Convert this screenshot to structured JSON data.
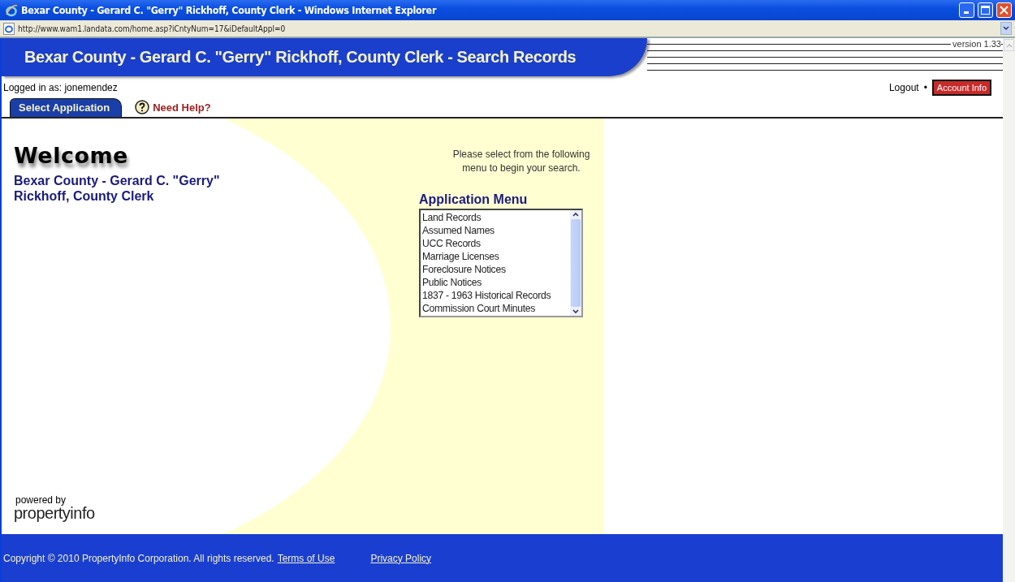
{
  "window": {
    "title": "Bexar County - Gerard C. \"Gerry\" Rickhoff, County Clerk - Windows Internet Explorer",
    "address": "http://www.wam1.landata.com/home.asp?iCntyNum=17&iDefaultAppl=0"
  },
  "header": {
    "title": "Bexar County - Gerard C. \"Gerry\" Rickhoff, County Clerk - Search Records",
    "version": "version 1.33"
  },
  "user_bar": {
    "logged_in_label": "Logged in as:",
    "username": "jonemendez",
    "logout": "Logout",
    "separator": "•",
    "account_button": "Account Info"
  },
  "tabs": [
    {
      "label": "Select Application",
      "selected": true
    }
  ],
  "help_link": "Need Help?",
  "welcome": {
    "heading": "Welcome",
    "subtitle": "Bexar County - Gerard C. \"Gerry\" Rickhoff, County Clerk"
  },
  "menu": {
    "instructions": "Please select from the following menu to begin your search.",
    "heading": "Application Menu",
    "items": [
      "Land Records",
      "Assumed Names",
      "UCC Records",
      "Marriage Licenses",
      "Foreclosure Notices",
      "Public Notices",
      "1837 - 1963 Historical Records",
      "Commission Court Minutes"
    ]
  },
  "powered_by": {
    "label": "powered by",
    "brand": "propertyinfo"
  },
  "footer": {
    "copyright": "Copyright © 2010 PropertyInfo Corporation. All rights reserved.",
    "links": [
      "Terms of Use",
      "Privacy Policy"
    ]
  }
}
